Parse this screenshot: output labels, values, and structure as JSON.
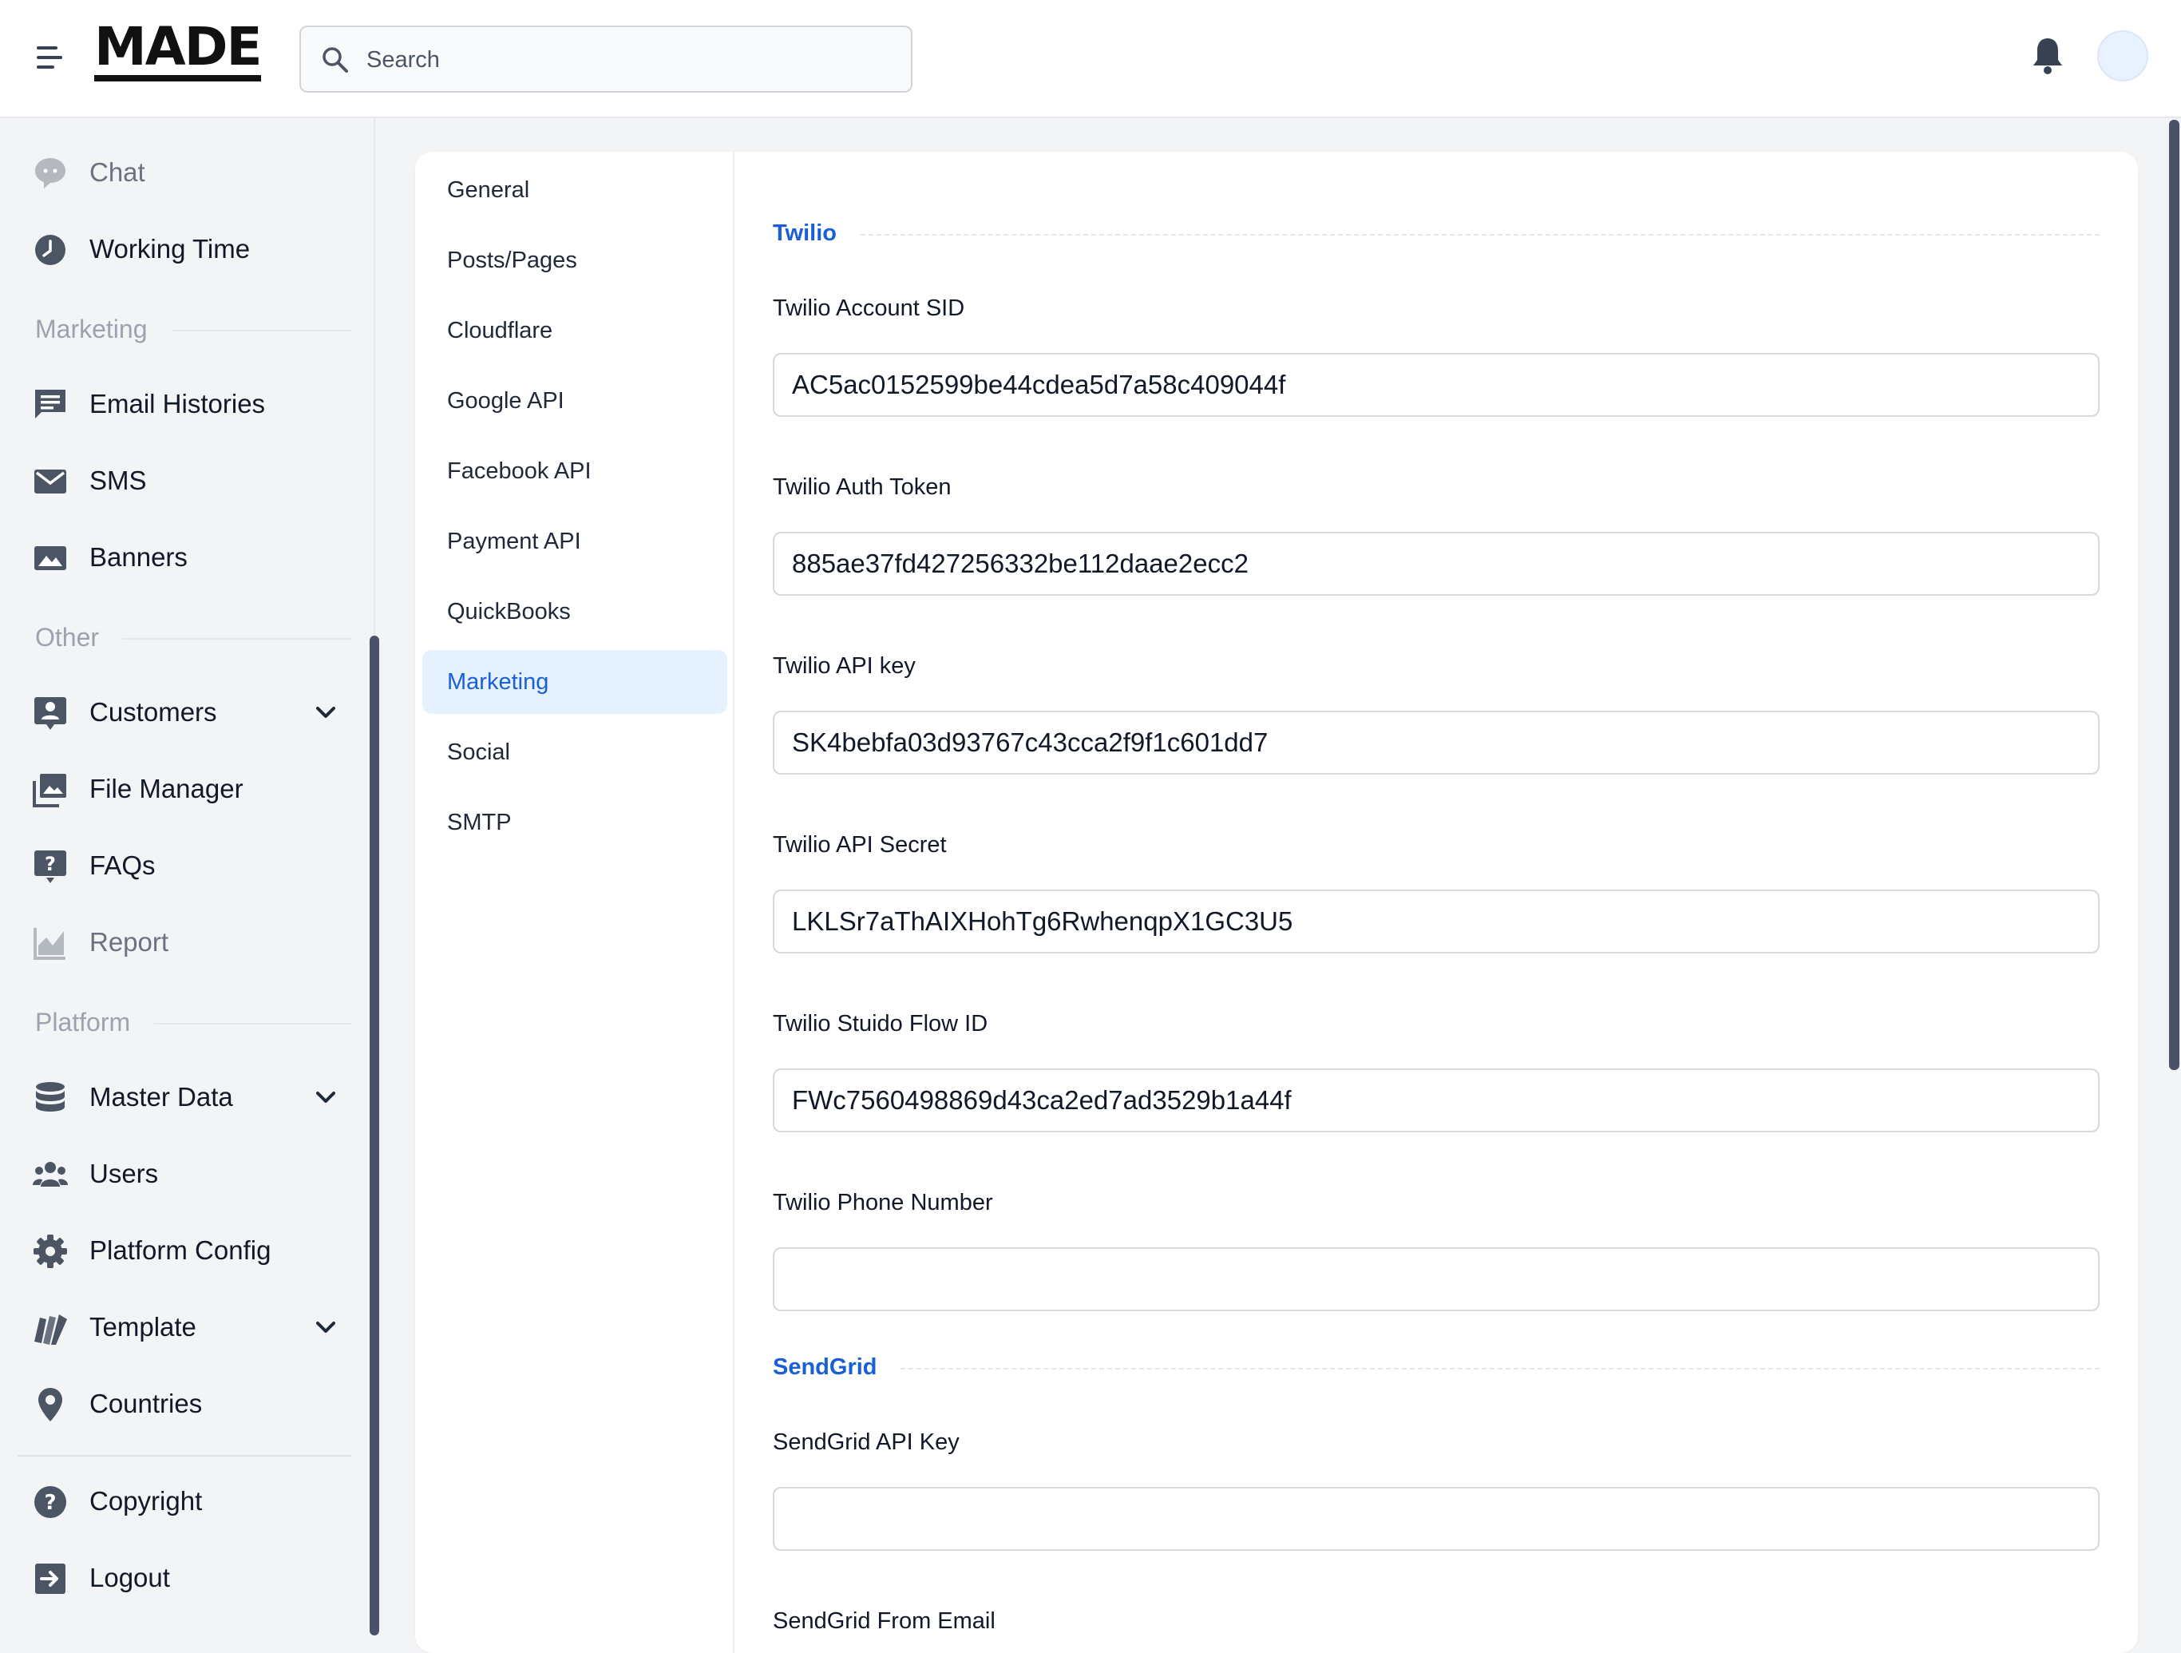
{
  "header": {
    "logo": "MADE",
    "search_placeholder": "Search"
  },
  "sidebar": {
    "items": [
      {
        "label": "Chat",
        "icon": "chat-bubble-icon",
        "dim": true
      },
      {
        "label": "Working Time",
        "icon": "clock-icon"
      },
      {
        "section": "Marketing"
      },
      {
        "label": "Email Histories",
        "icon": "message-icon"
      },
      {
        "label": "SMS",
        "icon": "mail-icon"
      },
      {
        "label": "Banners",
        "icon": "image-icon"
      },
      {
        "section": "Other"
      },
      {
        "label": "Customers",
        "icon": "customer-icon",
        "expandable": true
      },
      {
        "label": "File Manager",
        "icon": "gallery-icon"
      },
      {
        "label": "FAQs",
        "icon": "question-badge-icon"
      },
      {
        "label": "Report",
        "icon": "area-chart-icon",
        "dim": true
      },
      {
        "section": "Platform"
      },
      {
        "label": "Master Data",
        "icon": "database-icon",
        "expandable": true
      },
      {
        "label": "Users",
        "icon": "users-icon"
      },
      {
        "label": "Platform Config",
        "icon": "gear-icon"
      },
      {
        "label": "Template",
        "icon": "swatch-icon",
        "expandable": true
      },
      {
        "label": "Countries",
        "icon": "map-pin-icon"
      },
      {
        "label": "Copyright",
        "icon": "help-circle-icon"
      },
      {
        "label": "Logout",
        "icon": "logout-icon"
      }
    ]
  },
  "settings_nav": {
    "items": [
      "General",
      "Posts/Pages",
      "Cloudflare",
      "Google API",
      "Facebook API",
      "Payment API",
      "QuickBooks",
      "Marketing",
      "Social",
      "SMTP"
    ],
    "active": "Marketing"
  },
  "form": {
    "twilio": {
      "title": "Twilio",
      "account_sid_label": "Twilio Account SID",
      "account_sid": "AC5ac0152599be44cdea5d7a58c409044f",
      "auth_token_label": "Twilio Auth Token",
      "auth_token": "885ae37fd427256332be112daae2ecc2",
      "api_key_label": "Twilio API key",
      "api_key": "SK4bebfa03d93767c43cca2f9f1c601dd7",
      "api_secret_label": "Twilio API Secret",
      "api_secret": "LKLSr7aThAIXHohTg6RwhenqpX1GC3U5",
      "studio_flow_label": "Twilio Stuido Flow ID",
      "studio_flow": "FWc7560498869d43ca2ed7ad3529b1a44f",
      "phone_label": "Twilio Phone Number",
      "phone": ""
    },
    "sendgrid": {
      "title": "SendGrid",
      "api_key_label": "SendGrid API Key",
      "api_key": "",
      "from_email_label": "SendGrid From Email"
    }
  },
  "colors": {
    "accent": "#1a5fd6",
    "active_bg": "#e6f1ff",
    "scrollbar": "#4b5169"
  }
}
